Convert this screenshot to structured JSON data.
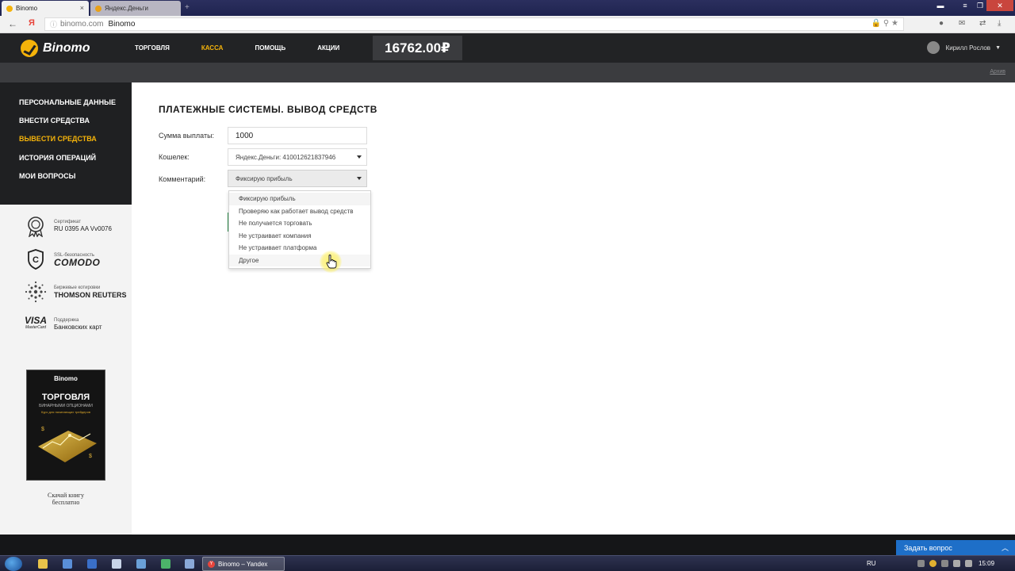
{
  "browser": {
    "tabs": [
      {
        "label": "Binomo",
        "active": true
      },
      {
        "label": "Яндекс.Деньги",
        "active": false
      }
    ],
    "address": {
      "domain": "binomo.com",
      "title": "Binomo"
    }
  },
  "header": {
    "logo": "Binomo",
    "nav": [
      {
        "label": "ТОРГОВЛЯ",
        "active": false
      },
      {
        "label": "КАССА",
        "active": true
      },
      {
        "label": "ПОМОЩЬ",
        "active": false
      },
      {
        "label": "АКЦИИ",
        "active": false
      }
    ],
    "balance": "16762.00₽",
    "user_name": "Кирилл Рослов",
    "archive_link": "Архив"
  },
  "sidebar": {
    "items": [
      {
        "label": "ПЕРСОНАЛЬНЫЕ ДАННЫЕ",
        "active": false
      },
      {
        "label": "ВНЕСТИ СРЕДСТВА",
        "active": false
      },
      {
        "label": "ВЫВЕСТИ СРЕДСТВА",
        "active": true
      },
      {
        "label": "ИСТОРИЯ ОПЕРАЦИЙ",
        "active": false
      },
      {
        "label": "МОИ ВОПРОСЫ",
        "active": false
      }
    ],
    "trust": [
      {
        "small": "Сертификат",
        "big": "RU 0395 AA Vv0076",
        "icon": "certificate-icon"
      },
      {
        "small": "SSL-безопасность",
        "big": "COMODO",
        "icon": "comodo-shield-icon"
      },
      {
        "small": "Биржевые котировки",
        "big": "THOMSON REUTERS",
        "icon": "reuters-icon"
      },
      {
        "small": "Поддержка",
        "big": "Банковских карт",
        "icon": "visa-mastercard-icon"
      }
    ],
    "visa_text": "VISA",
    "mastercard_text": "MasterCard",
    "book": {
      "brand": "Binomo",
      "title": "ТОРГОВЛЯ",
      "subtitle": "БИНАРНЫМИ ОПЦИОНАМИ",
      "subtitle2": "Курс для начинающих трейдеров",
      "caption_line1": "Скачай книгу",
      "caption_line2": "бесплатно"
    }
  },
  "main": {
    "title": "ПЛАТЕЖНЫЕ СИСТЕМЫ. ВЫВОД СРЕДСТВ",
    "amount_label": "Сумма выплаты:",
    "amount_value": "1000",
    "wallet_label": "Кошелек:",
    "wallet_value": "Яндекс.Деньги: 410012621837946",
    "comment_label": "Комментарий:",
    "comment_value": "Фиксирую прибыль",
    "comment_options": [
      "Фиксирую прибыль",
      "Проверяю как работает вывод средств",
      "Не получается торговать",
      "Не устраивает компания",
      "Не устраивает платформа",
      "Другое"
    ]
  },
  "chat": {
    "label": "Задать вопрос"
  },
  "taskbar": {
    "task_label": "Binomo – Yandex",
    "lang": "RU",
    "clock": "15:09"
  }
}
